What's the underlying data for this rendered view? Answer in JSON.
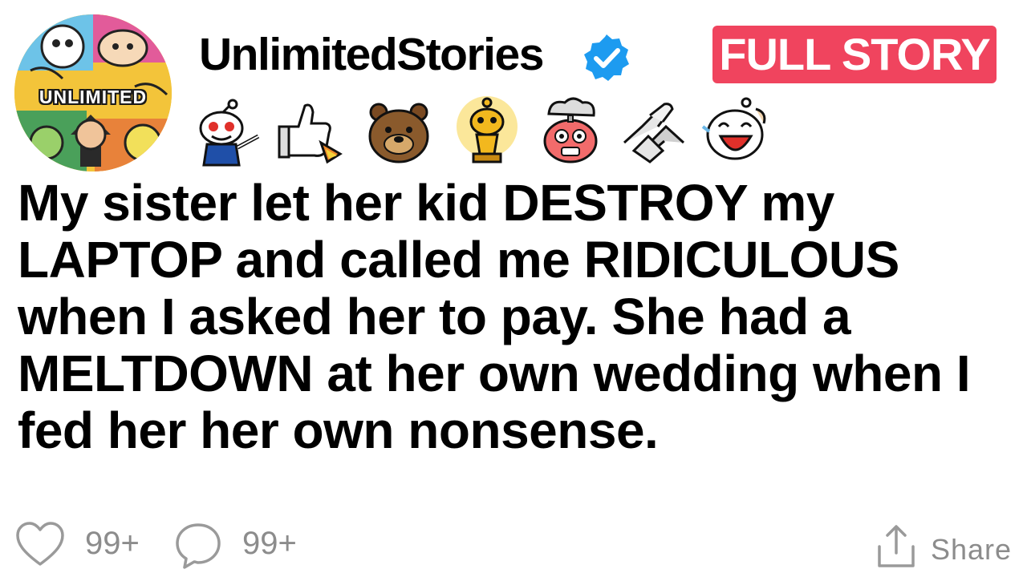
{
  "channel": {
    "avatar_text": "UNLIMITED",
    "username": "UnlimitedStories",
    "verified": true,
    "verified_icon": "verified-badge-icon"
  },
  "cta": {
    "label": "FULL STORY",
    "color": "#f0445e"
  },
  "awards": [
    {
      "name": "reddit-snoo-pointing-award"
    },
    {
      "name": "rocket-thumbs-up-award"
    },
    {
      "name": "bear-award"
    },
    {
      "name": "gold-trophy-snoo-award"
    },
    {
      "name": "mind-blown-award"
    },
    {
      "name": "handshake-award"
    },
    {
      "name": "laughing-snoo-award"
    }
  ],
  "post": {
    "title": "My sister let her kid DESTROY my LAPTOP and called me RIDICULOUS when I asked her to pay. She had a MELTDOWN at her own wedding when I fed her her own nonsense."
  },
  "footer": {
    "like_icon": "heart-icon",
    "like_count": "99+",
    "comment_icon": "comment-bubble-icon",
    "comment_count": "99+",
    "share_icon": "share-icon",
    "share_label": "Share"
  },
  "colors": {
    "accent": "#f0445e",
    "verified": "#1d9bf0",
    "muted_text": "#8c8c8c"
  }
}
